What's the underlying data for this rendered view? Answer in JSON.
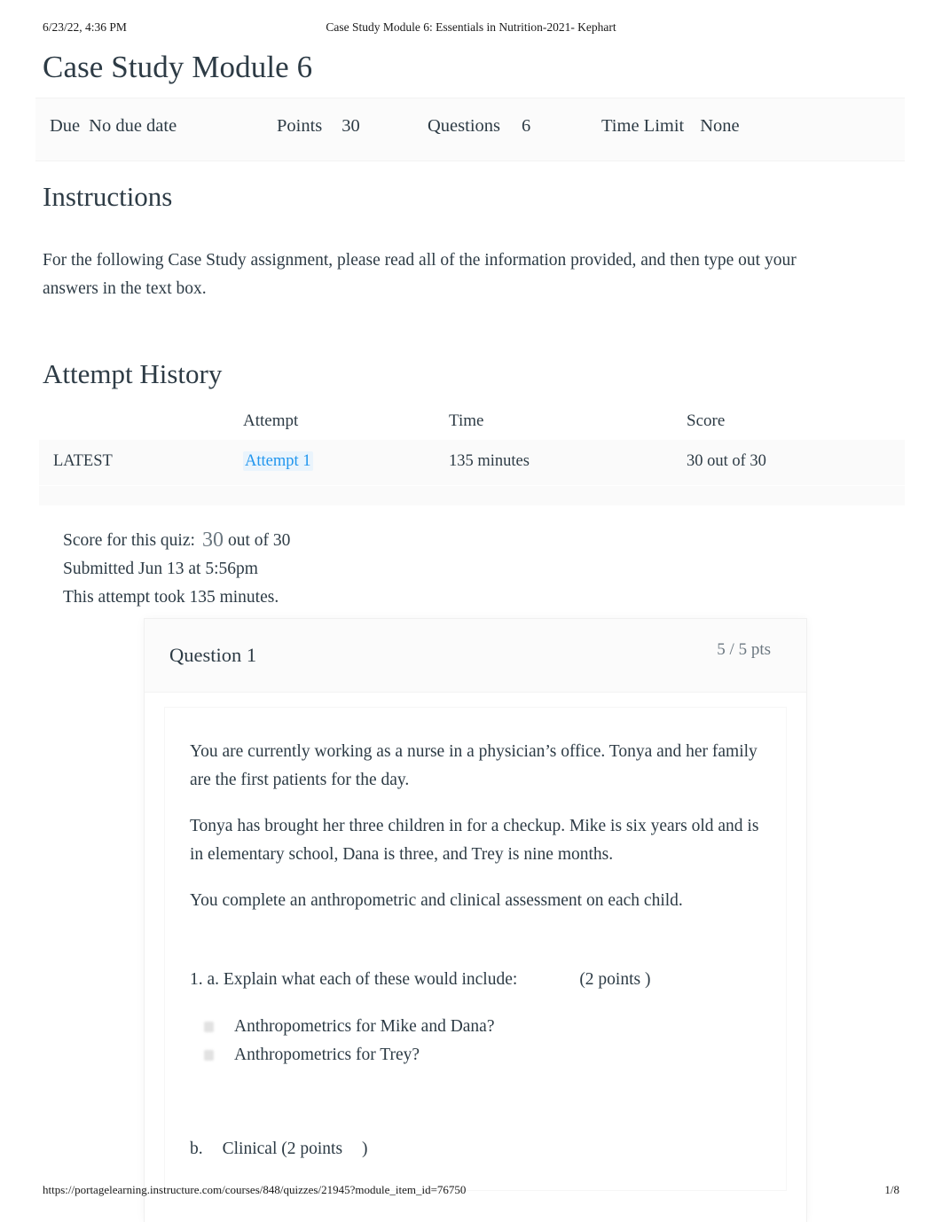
{
  "print_header": {
    "date": "6/23/22, 4:36 PM",
    "document_title": "Case Study Module 6: Essentials in Nutrition-2021- Kephart"
  },
  "page_title": "Case Study Module 6",
  "meta": {
    "due_label": "Due",
    "due_value": "No due date",
    "points_label": "Points",
    "points_value": "30",
    "questions_label": "Questions",
    "questions_value": "6",
    "time_limit_label": "Time Limit",
    "time_limit_value": "None"
  },
  "instructions": {
    "heading": "Instructions",
    "body": "For the following Case Study assignment, please read all of the information provided, and then type out your answers in the text box."
  },
  "attempt_history": {
    "heading": "Attempt History",
    "columns": [
      "",
      "Attempt",
      "Time",
      "Score"
    ],
    "rows": [
      {
        "status": "LATEST",
        "attempt": "Attempt 1",
        "time": "135 minutes",
        "score": "30 out of 30"
      }
    ]
  },
  "score_summary": {
    "score_label": "Score for this quiz:",
    "score_value": "30",
    "score_out_of": "out of 30",
    "submitted": "Submitted Jun 13 at 5:56pm",
    "duration": "This attempt took 135 minutes."
  },
  "question": {
    "name": "Question 1",
    "points": "5 / 5 pts",
    "paragraphs": [
      "You are currently working as a nurse in a physician’s office. Tonya and her family are the first patients for the day.",
      "Tonya has brought her three children in for a checkup. Mike is six years old and is in elementary school, Dana is three, and Trey is nine months.",
      "You complete an anthropometric and clinical assessment on each child."
    ],
    "prompt": "1. a. Explain what each of these would include:",
    "prompt_points": "(2 points   )",
    "sub_items": [
      "Anthropometrics for Mike and Dana?",
      "Anthropometrics for Trey?"
    ],
    "clinical_label": "b.",
    "clinical_text": "Clinical (2 points",
    "clinical_close": ")"
  },
  "print_footer": {
    "url": "https://portagelearning.instructure.com/courses/848/quizzes/21945?module_item_id=76750",
    "page": "1/8"
  },
  "colors": {
    "link_blue": "#2196ee",
    "text": "#2d3b45",
    "muted": "#6b7780",
    "row_bg": "#fafafa"
  }
}
